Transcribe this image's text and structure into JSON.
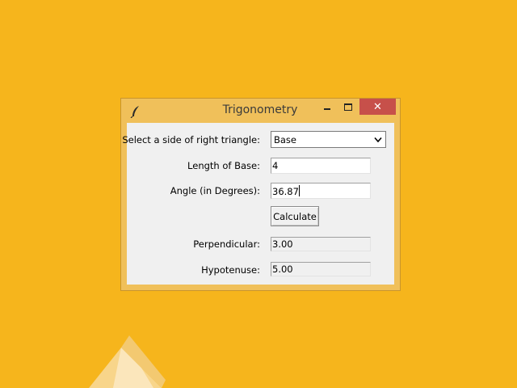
{
  "window": {
    "title": "Trigonometry",
    "controls": {
      "minimize": "minimize",
      "maximize": "maximize",
      "close": "✕"
    }
  },
  "form": {
    "side_label": "Select a side of right triangle:",
    "side_value": "Base",
    "length_label": "Length of Base:",
    "length_value": "4",
    "angle_label": "Angle (in Degrees):",
    "angle_value": "36.87",
    "calculate_label": "Calculate",
    "perpendicular_label": "Perpendicular:",
    "perpendicular_value": "3.00",
    "hypotenuse_label": "Hypotenuse:",
    "hypotenuse_value": "5.00"
  },
  "icons": {
    "app": "feather-icon",
    "dropdown": "chevron-down-icon"
  },
  "colors": {
    "desktop": "#f6b51c",
    "titlebar": "#f0c05a",
    "close_button": "#c7504a",
    "client": "#f0f0f0"
  }
}
